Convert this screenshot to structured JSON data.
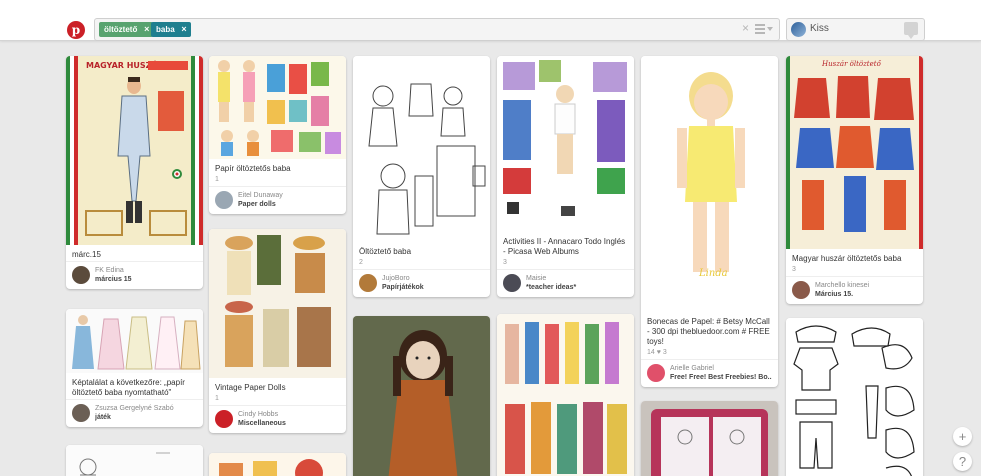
{
  "header": {
    "logo": "p",
    "chips": [
      {
        "label": "öltöztető",
        "color": "#58a36f"
      },
      {
        "label": "baba",
        "color": "#1f7f8f"
      }
    ],
    "chip_remove": "×",
    "clear": "×",
    "user_name": "Kiss"
  },
  "pins": [
    {
      "desc": "márc.15",
      "stats": "",
      "name": "FK Edina",
      "board": "március 15"
    },
    {
      "desc": "Papír öltöztetős baba",
      "stats": "1",
      "name": "Eitel Dunaway",
      "board": "Paper dolls"
    },
    {
      "desc": "Öltöztető baba",
      "stats": "2",
      "name": "JujoBoro",
      "board": "Papírjátékok"
    },
    {
      "desc": "Activities II - Annacaro Todo Inglés - Picasa Web Albums",
      "stats": "3",
      "name": "Maisie",
      "board": "*teacher ideas*"
    },
    {
      "desc": "Bonecas de Papel: # Betsy McCall - 300 dpi thebluedoor.com # FREE toys!",
      "stats": "14 ♥ 3",
      "name": "Arielle Gabriel",
      "board": "Free! Free! Best Freebies! Bo..."
    },
    {
      "desc": "Magyar huszár öltöztetős baba",
      "stats": "3",
      "name": "Marchello kinesei",
      "board": "Március 15."
    },
    {
      "desc": "Képtalálat a következőre: „papír öltöztető baba nyomtatható\"",
      "stats": "",
      "name": "Zsuzsa Gergelyné Szabó",
      "board": "játék"
    },
    {
      "desc": "Vintage Paper Dolls",
      "stats": "1",
      "name": "Cindy Hobbs",
      "board": "Miscellaneous"
    }
  ],
  "image_labels": {
    "doll_name": "Linda",
    "poster_title": "MAGYAR HUSZÁR",
    "poster_title_2": "Huszár öltöztető"
  },
  "float_buttons": {
    "add": "+",
    "help": "?"
  }
}
